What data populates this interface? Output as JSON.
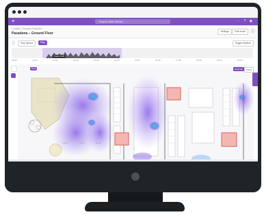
{
  "app": {
    "search_placeholder": "Search Main Street",
    "breadcrumb": "Location / Shopper Analytics",
    "page_title": "Pasadena – Ground Floor",
    "header_buttons": [
      "Settings",
      "Edit mode"
    ],
    "menu_icon": "hamburger-icon",
    "topbar_icons": [
      "help-icon",
      "notifications-icon",
      "avatar-icon"
    ]
  },
  "toolbar": {
    "view_mode": "Play Speed",
    "play_label": "Play",
    "right_label": "Toggle timeline"
  },
  "timeline": {
    "marker_label": "Peak 14:00",
    "ticks": [
      "09:00",
      "10:00",
      "11:00",
      "12:00",
      "13:00",
      "14:00",
      "15:00",
      "16:00",
      "17:00",
      "18:00",
      "19:00",
      "20:00"
    ]
  },
  "map": {
    "layer_chip": "Heat",
    "toggle_options": [
      "Heatmap",
      "Paths"
    ],
    "bottom_labels": [
      "00:15",
      "00:30",
      "00:45"
    ]
  },
  "colors": {
    "accent": "#7d4fc1",
    "heat_core": "#3ec9c9",
    "heat_mid": "#6b4ee0",
    "fixture_red": "#e8827d"
  }
}
